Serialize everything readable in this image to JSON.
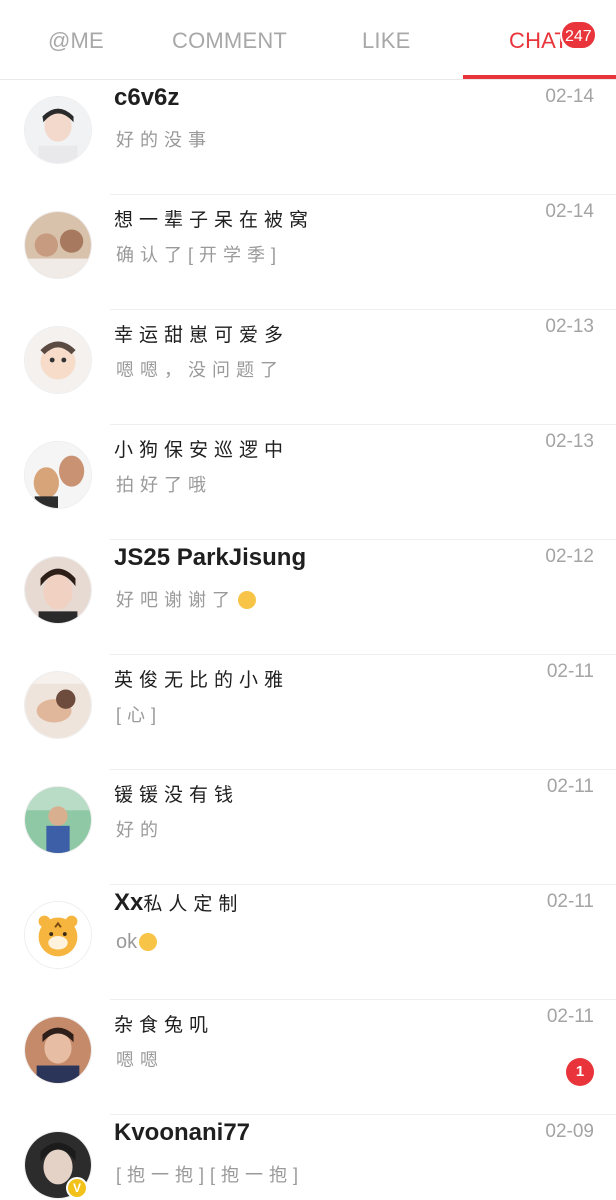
{
  "tabs": [
    {
      "label": "@ME"
    },
    {
      "label": "COMMENT"
    },
    {
      "label": "LIKE"
    },
    {
      "label": "CHAT",
      "badge": "247"
    }
  ],
  "colors": {
    "accent": "#e8343a",
    "muted": "#a4a4a4"
  },
  "conversations": [
    {
      "name": "c6v6z",
      "message": "好的没事",
      "time": "02-14"
    },
    {
      "name": "想一辈子呆在被窝",
      "message": "确认了[开学季]",
      "time": "02-14"
    },
    {
      "name": "幸运甜崽可爱多",
      "message": "嗯嗯，没问题了",
      "time": "02-13"
    },
    {
      "name": "小狗保安巡逻中",
      "message": "拍好了哦",
      "time": "02-13"
    },
    {
      "name": "JS25 ParkJisung",
      "message": "好吧谢谢了",
      "time": "02-12",
      "message_emoji": "crying-emoji"
    },
    {
      "name": "英俊无比的小雅",
      "message": "[心]",
      "time": "02-11"
    },
    {
      "name": "锾锾没有钱",
      "message": "好的",
      "time": "02-11"
    },
    {
      "name_latin": "Xx",
      "name_cn": "私人定制",
      "message": "ok",
      "time": "02-11",
      "message_emoji": "ok-hand-emoji"
    },
    {
      "name": "杂食兔叽",
      "message": "嗯嗯",
      "time": "02-11",
      "unread": "1"
    },
    {
      "name": "Kvoonani77",
      "message": "[抱一抱][抱一抱]",
      "time": "02-09",
      "verified": true
    }
  ]
}
